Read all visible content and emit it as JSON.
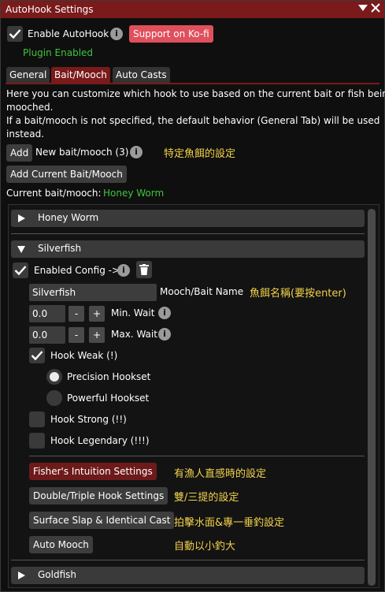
{
  "window": {
    "title": "AutoHook Settings",
    "controls": [
      "collapse-icon",
      "close-icon"
    ]
  },
  "header": {
    "enable_label": "Enable AutoHook",
    "support_label": "Support on Ko-fi",
    "status": "Plugin Enabled"
  },
  "tabs": [
    {
      "label": "General"
    },
    {
      "label": "Bait/Mooch",
      "active": true
    },
    {
      "label": "Auto Casts"
    }
  ],
  "description": {
    "line1": "Here you can customize which hook to use based on the current bait or fish being",
    "line2": "mooched.",
    "line3": "If a bait/mooch is not specified, the default behavior (General Tab) will be used",
    "line4": "instead."
  },
  "add_row": {
    "add_label": "Add",
    "new_label": "New bait/mooch (3)",
    "annotation": "特定魚餌的設定"
  },
  "add_current_label": "Add Current Bait/Mooch",
  "current": {
    "label": "Current bait/mooch:",
    "value": "Honey Worm"
  },
  "sections": {
    "honey_worm": "Honey Worm",
    "silverfish": "Silverfish",
    "goldfish": "Goldfish"
  },
  "silverfish_config": {
    "enabled_label": "Enabled Config ->",
    "name_value": "Silverfish",
    "name_label": "Mooch/Bait Name",
    "name_annotation": "魚餌名稱(要按enter)",
    "min_wait_value": "0.0",
    "min_wait_label": "Min. Wait",
    "max_wait_value": "0.0",
    "max_wait_label": "Max. Wait",
    "minus": "-",
    "plus": "+",
    "hook_weak_label": "Hook Weak (!)",
    "precision_label": "Precision Hookset",
    "powerful_label": "Powerful Hookset",
    "hook_strong_label": "Hook Strong (!!)",
    "hook_legendary_label": "Hook Legendary (!!!)",
    "fishers_intuition_label": "Fisher's Intuition Settings",
    "fishers_intuition_annotation": "有漁人直感時的設定",
    "double_triple_label": "Double/Triple Hook Settings",
    "double_triple_annotation": "雙/三提的設定",
    "surface_slap_label": "Surface Slap & Identical Cast",
    "surface_slap_annotation": "拍擊水面&專一垂釣設定",
    "auto_mooch_label": "Auto Mooch",
    "auto_mooch_annotation": "自動以小釣大"
  },
  "info_glyph": "i",
  "colors": {
    "accent": "#7a1a1a",
    "kofi": "#e0505c",
    "status_green": "#3ec43e",
    "annotation_yellow": "#f3d24a"
  },
  "state": {
    "enable_autohook": true,
    "silverfish_enabled": true,
    "hook_weak": true,
    "hookset": "Precision Hookset",
    "hook_strong": false,
    "hook_legendary": false
  }
}
